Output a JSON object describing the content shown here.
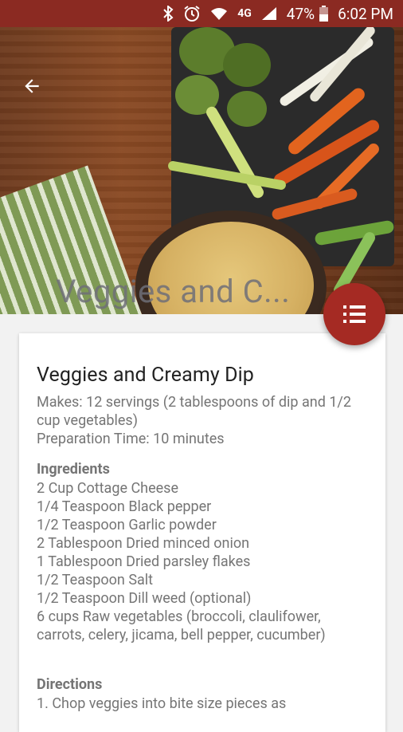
{
  "status_bar": {
    "bluetooth_icon": "bluetooth-icon",
    "alarm_icon": "alarm-icon",
    "wifi_icon": "wifi-icon",
    "network": "4G",
    "signal_icon": "signal-icon",
    "battery": "47%",
    "time": "6:02 PM"
  },
  "hero": {
    "back_icon": "arrow-back-icon",
    "overlay_title": "Veggies and C..."
  },
  "fab": {
    "icon": "list-icon"
  },
  "recipe": {
    "title": "Veggies and Creamy Dip",
    "makes": "Makes: 12 servings  (2 tablespoons of dip and 1/2 cup vegetables)",
    "prep_time": "Preparation Time: 10 minutes",
    "ingredients_label": "Ingredients",
    "ingredients": [
      "2 Cup Cottage Cheese",
      "1/4 Teaspoon Black pepper",
      "1/2 Teaspoon Garlic powder",
      "2 Tablespoon Dried minced onion",
      "1 Tablespoon Dried parsley flakes",
      "1/2 Teaspoon Salt",
      "1/2 Teaspoon Dill weed (optional)",
      "6 cups Raw vegetables (broccoli, claulifower, carrots, celery, jicama, bell pepper, cucumber)"
    ],
    "directions_label": "Directions",
    "directions_first": "1. Chop veggies into bite size pieces as"
  },
  "colors": {
    "status_bar": "#8b2a22",
    "fab": "#a52a23"
  }
}
